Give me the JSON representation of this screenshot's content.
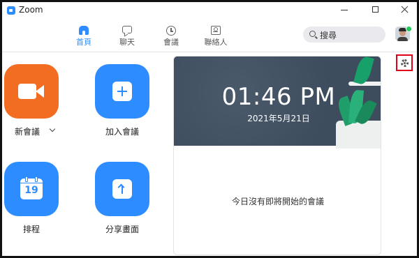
{
  "window": {
    "title": "Zoom"
  },
  "nav": {
    "home": "首頁",
    "chat": "聊天",
    "meetings": "會議",
    "contacts": "聯絡人"
  },
  "search": {
    "label": "搜尋"
  },
  "actions": {
    "new_meeting": "新會議",
    "join": "加入會議",
    "schedule": "排程",
    "schedule_day": "19",
    "share_screen": "分享畫面"
  },
  "calendar": {
    "time": "01:46 PM",
    "date": "2021年5月21日",
    "empty": "今日沒有即將開始的會議"
  },
  "colors": {
    "accent": "#2d8cff",
    "new_meeting": "#f26d21",
    "presence": "#24c75c",
    "highlight": "#e0001a"
  }
}
